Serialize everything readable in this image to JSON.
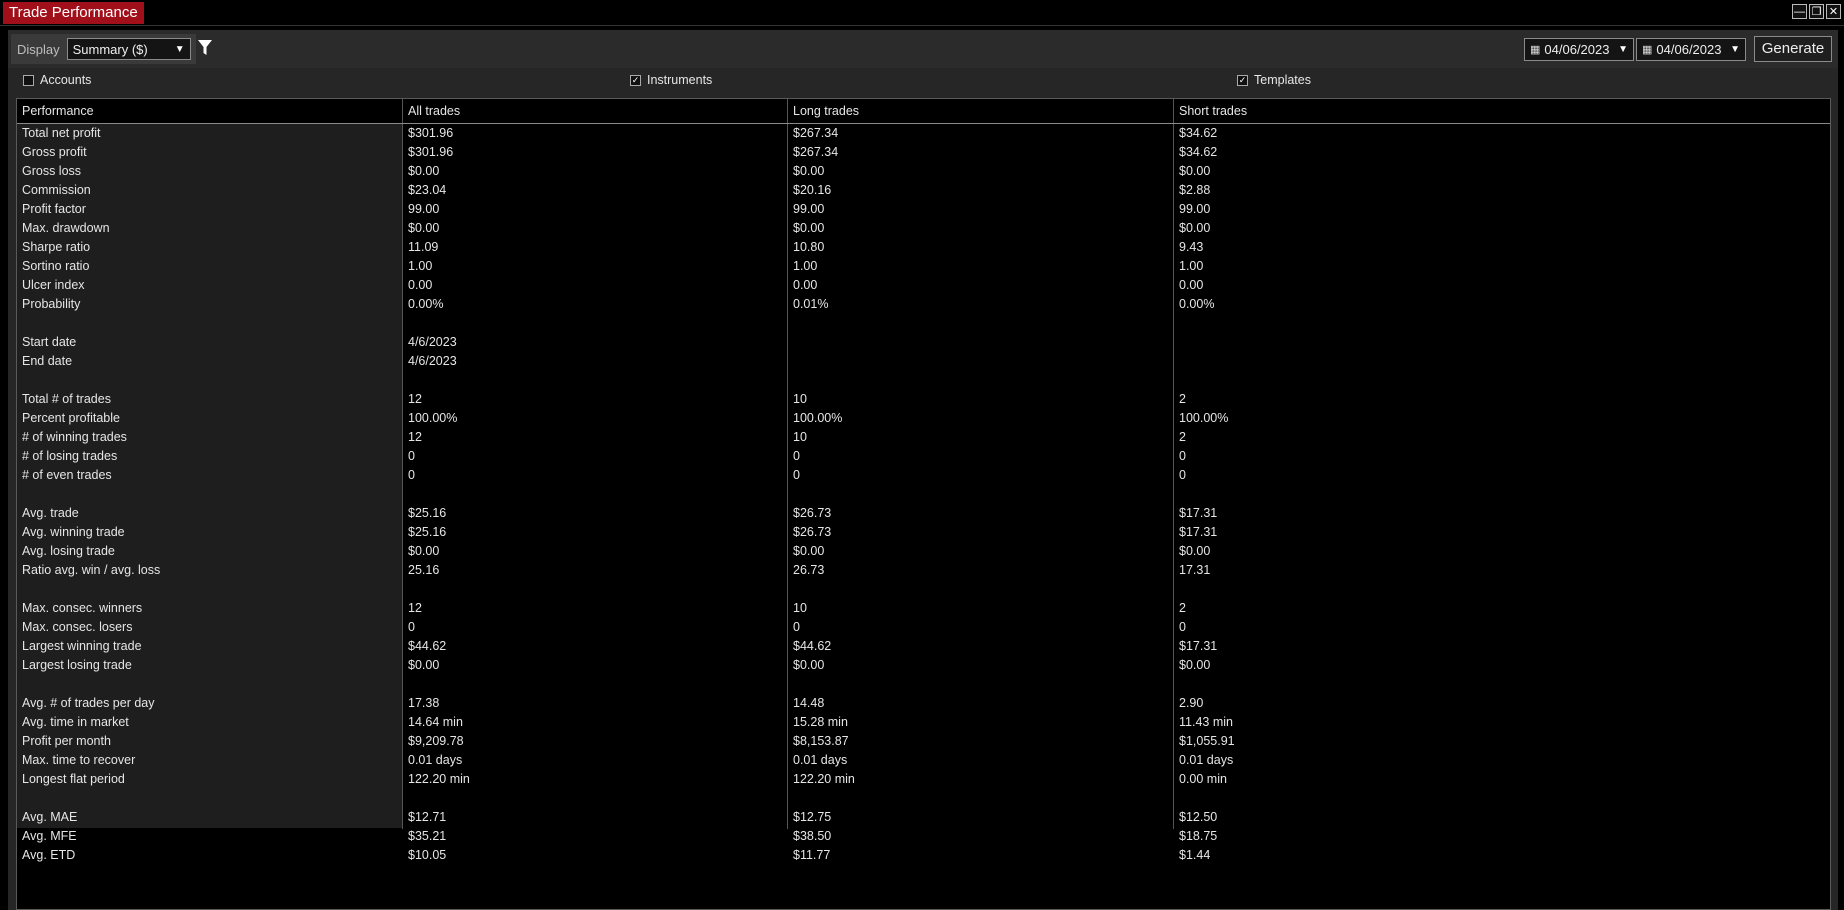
{
  "window": {
    "title": "Trade Performance",
    "buttons": [
      "—",
      "❐",
      "✕"
    ]
  },
  "toolbar": {
    "display_label": "Display",
    "display_value": "Summary ($)",
    "from_date": "04/06/2023",
    "to_date": "04/06/2023",
    "generate_label": "Generate"
  },
  "options": {
    "accounts": {
      "label": "Accounts",
      "checked": false
    },
    "instruments": {
      "label": "Instruments",
      "checked": true
    },
    "templates": {
      "label": "Templates",
      "checked": true
    }
  },
  "table": {
    "headers": [
      "Performance",
      "All trades",
      "Long trades",
      "Short trades"
    ],
    "rows": [
      [
        "Total net profit",
        "$301.96",
        "$267.34",
        "$34.62"
      ],
      [
        "Gross profit",
        "$301.96",
        "$267.34",
        "$34.62"
      ],
      [
        "Gross loss",
        "$0.00",
        "$0.00",
        "$0.00"
      ],
      [
        "Commission",
        "$23.04",
        "$20.16",
        "$2.88"
      ],
      [
        "Profit factor",
        "99.00",
        "99.00",
        "99.00"
      ],
      [
        "Max. drawdown",
        "$0.00",
        "$0.00",
        "$0.00"
      ],
      [
        "Sharpe ratio",
        "11.09",
        "10.80",
        "9.43"
      ],
      [
        "Sortino ratio",
        "1.00",
        "1.00",
        "1.00"
      ],
      [
        "Ulcer index",
        "0.00",
        "0.00",
        "0.00"
      ],
      [
        "Probability",
        "0.00%",
        "0.01%",
        "0.00%"
      ],
      [
        "",
        "",
        "",
        ""
      ],
      [
        "Start date",
        "4/6/2023",
        "",
        ""
      ],
      [
        "End date",
        "4/6/2023",
        "",
        ""
      ],
      [
        "",
        "",
        "",
        ""
      ],
      [
        "Total # of trades",
        "12",
        "10",
        "2"
      ],
      [
        "Percent profitable",
        "100.00%",
        "100.00%",
        "100.00%"
      ],
      [
        "# of winning trades",
        "12",
        "10",
        "2"
      ],
      [
        "# of losing trades",
        "0",
        "0",
        "0"
      ],
      [
        "# of even trades",
        "0",
        "0",
        "0"
      ],
      [
        "",
        "",
        "",
        ""
      ],
      [
        "Avg. trade",
        "$25.16",
        "$26.73",
        "$17.31"
      ],
      [
        "Avg. winning trade",
        "$25.16",
        "$26.73",
        "$17.31"
      ],
      [
        "Avg. losing trade",
        "$0.00",
        "$0.00",
        "$0.00"
      ],
      [
        "Ratio avg. win / avg. loss",
        "25.16",
        "26.73",
        "17.31"
      ],
      [
        "",
        "",
        "",
        ""
      ],
      [
        "Max. consec. winners",
        "12",
        "10",
        "2"
      ],
      [
        "Max. consec. losers",
        "0",
        "0",
        "0"
      ],
      [
        "Largest winning trade",
        "$44.62",
        "$44.62",
        "$17.31"
      ],
      [
        "Largest losing trade",
        "$0.00",
        "$0.00",
        "$0.00"
      ],
      [
        "",
        "",
        "",
        ""
      ],
      [
        "Avg. # of trades per day",
        "17.38",
        "14.48",
        "2.90"
      ],
      [
        "Avg. time in market",
        "14.64 min",
        "15.28 min",
        "11.43 min"
      ],
      [
        "Profit per month",
        "$9,209.78",
        "$8,153.87",
        "$1,055.91"
      ],
      [
        "Max. time to recover",
        "0.01 days",
        "0.01 days",
        "0.01 days"
      ],
      [
        "Longest flat period",
        "122.20 min",
        "122.20 min",
        "0.00 min"
      ],
      [
        "",
        "",
        "",
        ""
      ],
      [
        "Avg. MAE",
        "$12.71",
        "$12.75",
        "$12.50"
      ],
      [
        "Avg. MFE",
        "$35.21",
        "$38.50",
        "$18.75"
      ],
      [
        "Avg. ETD",
        "$10.05",
        "$11.77",
        "$1.44"
      ]
    ]
  },
  "colors": {
    "title_bg": "#a10f1a",
    "toolbar_bg": "#2b2b2b",
    "grid_bg": "#000000",
    "first_col_bg": "#1e1e1e",
    "text": "#e6e6e6"
  }
}
